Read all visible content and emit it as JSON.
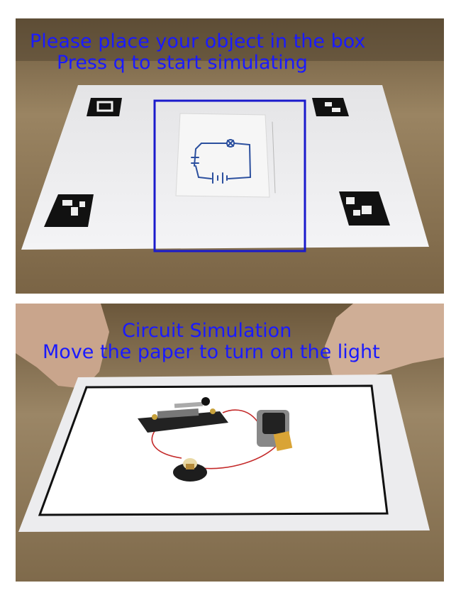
{
  "top_view": {
    "instruction_line1": "Please place your object in the box",
    "instruction_line2": "Press q to start simulating",
    "colors": {
      "overlay_text": "#1a1aff",
      "box_outline": "#1a1acc"
    }
  },
  "bottom_view": {
    "title": "Circuit Simulation",
    "instruction": "Move the paper to turn on the light",
    "colors": {
      "overlay_text": "#1a1aff"
    }
  },
  "icons": [
    "aruco-marker-icon",
    "circuit-sketch-icon",
    "knife-switch-icon",
    "battery-holder-icon",
    "light-bulb-icon"
  ]
}
